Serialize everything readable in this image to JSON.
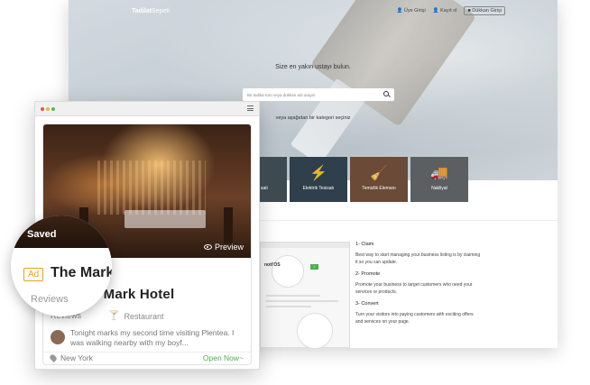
{
  "desktop": {
    "logo_bold": "Tadilat",
    "logo_rest": "Sepeti",
    "nav": {
      "login": "Üye Girişi",
      "register": "Kayıt ol",
      "shop_login": "Dükkan Girişi"
    },
    "tagline": "Size en yakın ustayı bulun.",
    "search_placeholder": "Bir tadilat türü veya dükkan adı arayın",
    "or_select": "veya aşağıdan bir kategori seçiniz",
    "categories": [
      {
        "label": "sati",
        "icon": "tile-icon"
      },
      {
        "label": "Elektrik Tesisatı",
        "icon": "lightning-icon"
      },
      {
        "label": "Temizlik Elemanı",
        "icon": "broom-icon"
      },
      {
        "label": "Nakliyat",
        "icon": "truck-icon"
      }
    ],
    "mock_logo": "noti'OS",
    "steps": [
      {
        "title": "1- Claim",
        "text": "Best way to start managing your business listing is by claiming it so you can update."
      },
      {
        "title": "2- Promote",
        "text": "Promote your business to target customers who need your services or products."
      },
      {
        "title": "3- Convert",
        "text": "Turn your visitors into paying customers with exciting offers and services on your page."
      }
    ]
  },
  "mobile": {
    "dots": [
      "#e0554a",
      "#e8b73a",
      "#5bb55a"
    ],
    "saved": "Saved",
    "preview": "Preview",
    "ad": "Ad",
    "hotel_name": "The Mark Hotel",
    "reviews": "Reviews",
    "category": "Restaurant",
    "review_text": "Tonight marks my second time visiting Plentea. I was walking nearby with my boyf...",
    "location": "New York",
    "status": "Open Now~",
    "magnifier_title": "The Mark"
  },
  "colors": {
    "ad_accent": "#e6a02a",
    "open_green": "#4caf50",
    "restaurant_icon": "#7aa7d8"
  }
}
